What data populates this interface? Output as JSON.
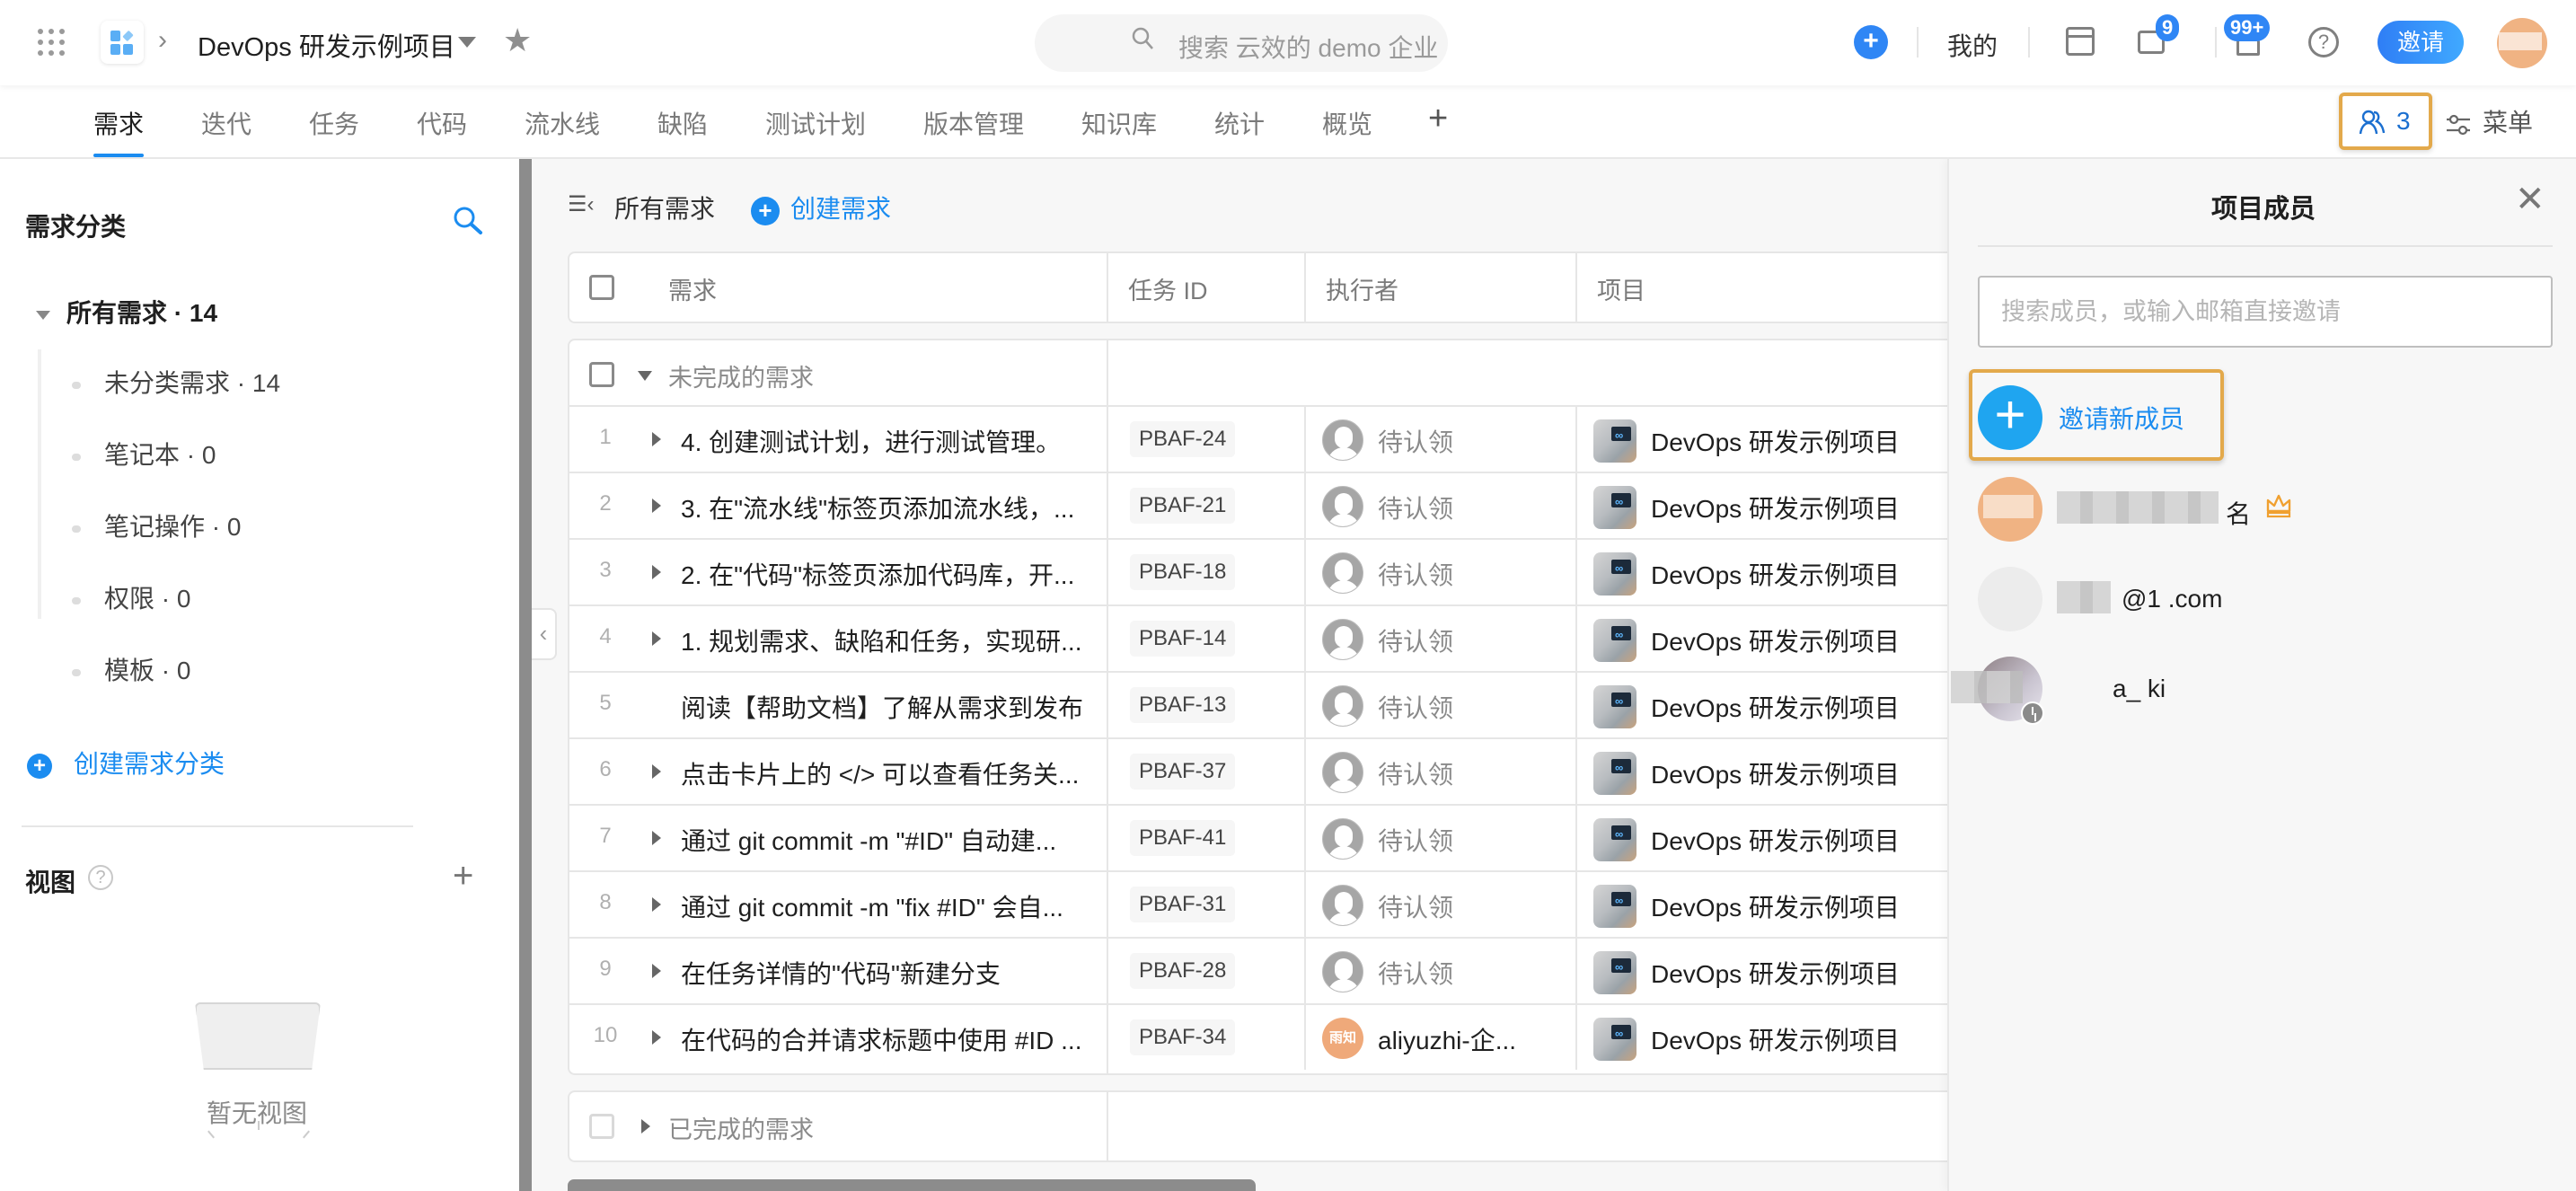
{
  "topbar": {
    "project_name": "DevOps 研发示例项目",
    "search_placeholder": "搜索 云效的 demo 企业",
    "mine_label": "我的",
    "message_badge": "9",
    "notification_badge": "99+",
    "invite_label": "邀请",
    "help_glyph": "?",
    "create_glyph": "+"
  },
  "tabs": [
    {
      "label": "需求",
      "active": true
    },
    {
      "label": "迭代"
    },
    {
      "label": "任务"
    },
    {
      "label": "代码"
    },
    {
      "label": "流水线"
    },
    {
      "label": "缺陷"
    },
    {
      "label": "测试计划"
    },
    {
      "label": "版本管理"
    },
    {
      "label": "知识库"
    },
    {
      "label": "统计"
    },
    {
      "label": "概览"
    }
  ],
  "tabbar": {
    "add_glyph": "+",
    "members_count": "3",
    "menu_label": "菜单"
  },
  "sidebar": {
    "title": "需求分类",
    "root": {
      "label": "所有需求 · 14"
    },
    "items": [
      {
        "label": "未分类需求 · 14"
      },
      {
        "label": "笔记本 · 0"
      },
      {
        "label": "笔记操作 · 0"
      },
      {
        "label": "权限 · 0"
      },
      {
        "label": "模板 · 0"
      }
    ],
    "create_label": "创建需求分类",
    "views_title": "视图",
    "views_empty": "暂无视图"
  },
  "main": {
    "toggle_glyph": "☰‹",
    "current_view": "所有需求",
    "create_label": "创建需求",
    "columns": [
      "需求",
      "任务 ID",
      "执行者",
      "项目"
    ],
    "open_group": "未完成的需求",
    "done_group": "已完成的需求",
    "rows": [
      {
        "num": "1",
        "expandable": true,
        "title": "4. 创建测试计划，进行测试管理。",
        "id": "PBAF-24",
        "assignee": "待认领",
        "assigned": false,
        "project": "DevOps 研发示例项目"
      },
      {
        "num": "2",
        "expandable": true,
        "title": "3. 在\"流水线\"标签页添加流水线，...",
        "id": "PBAF-21",
        "assignee": "待认领",
        "assigned": false,
        "project": "DevOps 研发示例项目"
      },
      {
        "num": "3",
        "expandable": true,
        "title": "2. 在\"代码\"标签页添加代码库，开...",
        "id": "PBAF-18",
        "assignee": "待认领",
        "assigned": false,
        "project": "DevOps 研发示例项目"
      },
      {
        "num": "4",
        "expandable": true,
        "title": "1. 规划需求、缺陷和任务，实现研...",
        "id": "PBAF-14",
        "assignee": "待认领",
        "assigned": false,
        "project": "DevOps 研发示例项目"
      },
      {
        "num": "5",
        "expandable": false,
        "title": "阅读【帮助文档】了解从需求到发布",
        "id": "PBAF-13",
        "assignee": "待认领",
        "assigned": false,
        "project": "DevOps 研发示例项目"
      },
      {
        "num": "6",
        "expandable": true,
        "title": "点击卡片上的 </> 可以查看任务关...",
        "id": "PBAF-37",
        "assignee": "待认领",
        "assigned": false,
        "project": "DevOps 研发示例项目"
      },
      {
        "num": "7",
        "expandable": true,
        "title": "通过 git commit -m \"#ID\" 自动建...",
        "id": "PBAF-41",
        "assignee": "待认领",
        "assigned": false,
        "project": "DevOps 研发示例项目"
      },
      {
        "num": "8",
        "expandable": true,
        "title": "通过 git commit -m \"fix #ID\" 会自...",
        "id": "PBAF-31",
        "assignee": "待认领",
        "assigned": false,
        "project": "DevOps 研发示例项目"
      },
      {
        "num": "9",
        "expandable": true,
        "title": "在任务详情的\"代码\"新建分支",
        "id": "PBAF-28",
        "assignee": "待认领",
        "assigned": false,
        "project": "DevOps 研发示例项目"
      },
      {
        "num": "10",
        "expandable": true,
        "title": "在代码的合并请求标题中使用 #ID ...",
        "id": "PBAF-34",
        "assignee": "aliyuzhi-企...",
        "assigned": true,
        "avatar_text": "雨知",
        "project": "DevOps 研发示例项目"
      }
    ]
  },
  "panel": {
    "title": "项目成员",
    "search_placeholder": "搜索成员，或输入邮箱直接邀请",
    "invite_new_label": "邀请新成员",
    "members": [
      {
        "name_visible": "名",
        "avatar_color": "#f0b383",
        "role_icon": "crown",
        "obscured": true
      },
      {
        "name_visible": "@1  .com",
        "avatar_color": "#ececec",
        "obscured": true
      },
      {
        "name_visible": "a_  ki",
        "avatar_color": "#b9b3b8",
        "status_icon": "clock",
        "obscured": true
      }
    ]
  },
  "colors": {
    "accent": "#1b8cf0",
    "highlight": "#e3a94b",
    "avatar_orange": "#efa97a"
  }
}
